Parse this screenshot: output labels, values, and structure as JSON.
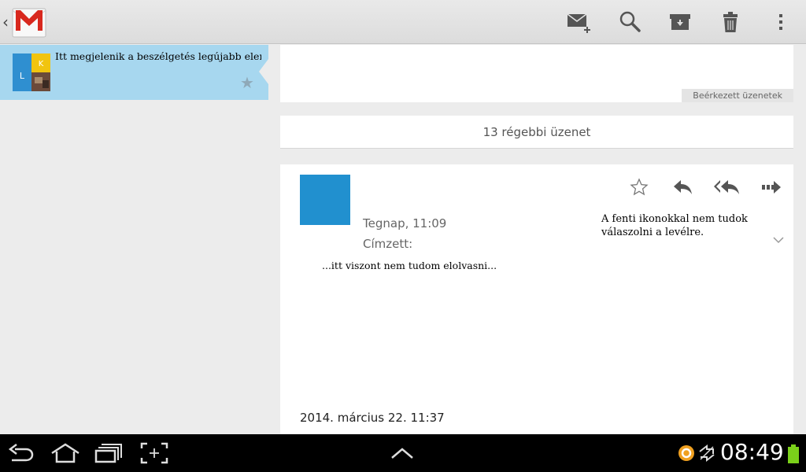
{
  "action_bar": {
    "up_caret": "‹",
    "logo_icon": "gmail-logo-icon",
    "actions": [
      "compose-icon",
      "search-icon",
      "archive-icon",
      "delete-icon",
      "overflow-menu-icon"
    ]
  },
  "conversation_list": {
    "items": [
      {
        "snippet": "Itt megjelenik a beszélgetés legújabb eleme...",
        "starred": false,
        "star_glyph": "★"
      }
    ]
  },
  "conversation": {
    "folder_label": "Beérkezett üzenetek",
    "older_messages": "13 régebbi üzenet",
    "message": {
      "time": "Tegnap, 11:09",
      "to_label": "Címzett:",
      "body": "...itt viszont nem tudom elolvasni...",
      "note": "A fenti ikonokkal nem tudok válaszolni a levélre.",
      "date": "2014. március 22. 11:37",
      "star_glyph": "☆",
      "actions": [
        "star-icon",
        "reply-icon",
        "reply-all-icon",
        "forward-icon"
      ]
    }
  },
  "system_bar": {
    "clock": "08:49",
    "colors": {
      "battery": "#7ad01a",
      "notification": "#f0a020"
    }
  },
  "colors": {
    "selected_item": "#a7d7ef",
    "sender_avatar": "#2190cf",
    "gmail_red": "#d8281e"
  }
}
